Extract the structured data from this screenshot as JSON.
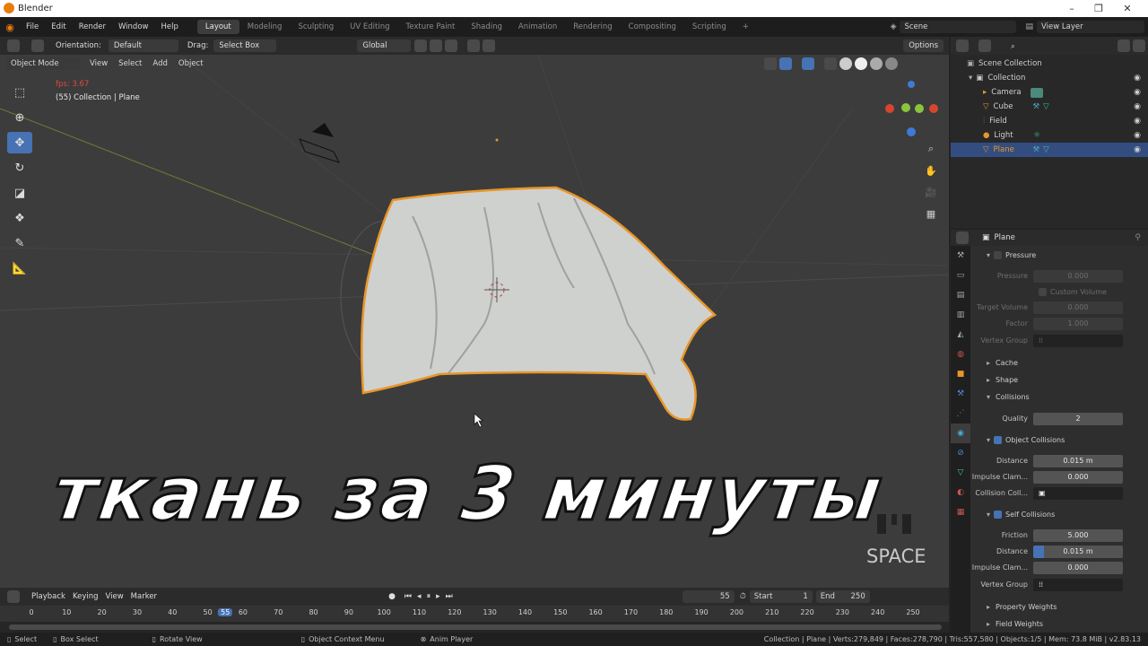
{
  "app": {
    "title": "Blender"
  },
  "menu": [
    "File",
    "Edit",
    "Render",
    "Window",
    "Help"
  ],
  "workspaces": [
    "Layout",
    "Modeling",
    "Sculpting",
    "UV Editing",
    "Texture Paint",
    "Shading",
    "Animation",
    "Rendering",
    "Compositing",
    "Scripting"
  ],
  "active_workspace": "Layout",
  "scene": {
    "name": "Scene",
    "view_layer": "View Layer"
  },
  "viewport_header": {
    "orientation_label": "Orientation:",
    "orientation_value": "Default",
    "drag_label": "Drag:",
    "drag_value": "Select Box",
    "transform_orientation": "Global",
    "options_label": "Options"
  },
  "viewport_menu": {
    "mode": "Object Mode",
    "items": [
      "View",
      "Select",
      "Add",
      "Object"
    ]
  },
  "viewport_info": {
    "fps": "fps: 3.67",
    "collection": "(55) Collection | Plane"
  },
  "overlay": {
    "title": "ткань за 3 минуты",
    "watermark": "SPACE"
  },
  "outliner": {
    "root": "Scene Collection",
    "collection": "Collection",
    "items": [
      {
        "name": "Camera",
        "selected": false
      },
      {
        "name": "Cube",
        "selected": false
      },
      {
        "name": "Field",
        "selected": false
      },
      {
        "name": "Light",
        "selected": false
      },
      {
        "name": "Plane",
        "selected": true
      }
    ]
  },
  "properties": {
    "object": "Plane",
    "pressure": {
      "label": "Pressure",
      "pressure_label": "Pressure",
      "pressure_value": "0.000",
      "custom_volume": "Custom Volume",
      "target_volume_label": "Target Volume",
      "target_volume_value": "0.000",
      "factor_label": "Factor",
      "factor_value": "1.000",
      "vertex_group_label": "Vertex Group"
    },
    "sections": [
      "Cache",
      "Shape",
      "Collisions"
    ],
    "quality_label": "Quality",
    "quality_value": "2",
    "object_collisions": {
      "label": "Object Collisions",
      "distance_label": "Distance",
      "distance_value": "0.015 m",
      "impulse_label": "Impulse Clam...",
      "impulse_value": "0.000",
      "collection_label": "Collision Coll..."
    },
    "self_collisions": {
      "label": "Self Collisions",
      "friction_label": "Friction",
      "friction_value": "5.000",
      "distance_label": "Distance",
      "distance_value": "0.015 m",
      "impulse_label": "Impulse Clam...",
      "impulse_value": "0.000",
      "vertex_group_label": "Vertex Group"
    },
    "more_sections": [
      "Property Weights",
      "Field Weights"
    ]
  },
  "timeline": {
    "menu": [
      "Playback",
      "Keying",
      "View",
      "Marker"
    ],
    "current_frame": "55",
    "start_label": "Start",
    "start_value": "1",
    "end_label": "End",
    "end_value": "250",
    "ticks": [
      "0",
      "10",
      "20",
      "30",
      "40",
      "50",
      "55",
      "60",
      "70",
      "80",
      "90",
      "100",
      "110",
      "120",
      "130",
      "140",
      "150",
      "160",
      "170",
      "180",
      "190",
      "200",
      "210",
      "220",
      "230",
      "240",
      "250"
    ]
  },
  "statusbar": {
    "select": "Select",
    "box_select": "Box Select",
    "rotate_view": "Rotate View",
    "context_menu": "Object Context Menu",
    "anim_player": "Anim Player",
    "stats": "Collection | Plane | Verts:279,849 | Faces:278,790 | Tris:557,580 | Objects:1/5 | Mem: 73.8 MiB | v2.83.13"
  },
  "colors": {
    "accent": "#4772b3",
    "selection_outline": "#e8962a",
    "viewport_bg": "#3c3c3c"
  }
}
